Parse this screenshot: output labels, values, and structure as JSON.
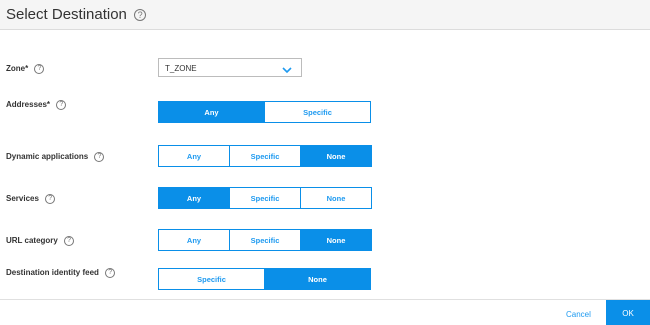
{
  "dialog": {
    "title": "Select Destination"
  },
  "help_glyph": "?",
  "zone": {
    "label": "Zone*",
    "value": "T_ZONE"
  },
  "addresses": {
    "label": "Addresses*",
    "options": [
      "Any",
      "Specific"
    ],
    "selected": "Any"
  },
  "dynamic_applications": {
    "label": "Dynamic applications",
    "options": [
      "Any",
      "Specific",
      "None"
    ],
    "selected": "None"
  },
  "services": {
    "label": "Services",
    "options": [
      "Any",
      "Specific",
      "None"
    ],
    "selected": "Any"
  },
  "url_category": {
    "label": "URL category",
    "options": [
      "Any",
      "Specific",
      "None"
    ],
    "selected": "None"
  },
  "destination_identity_feed": {
    "label": "Destination identity feed",
    "options": [
      "Specific",
      "None"
    ],
    "selected": "None"
  },
  "footer": {
    "cancel_label": "Cancel",
    "ok_label": "OK"
  },
  "colors": {
    "accent": "#0a8fe8",
    "header_bg": "#f5f5f5"
  }
}
